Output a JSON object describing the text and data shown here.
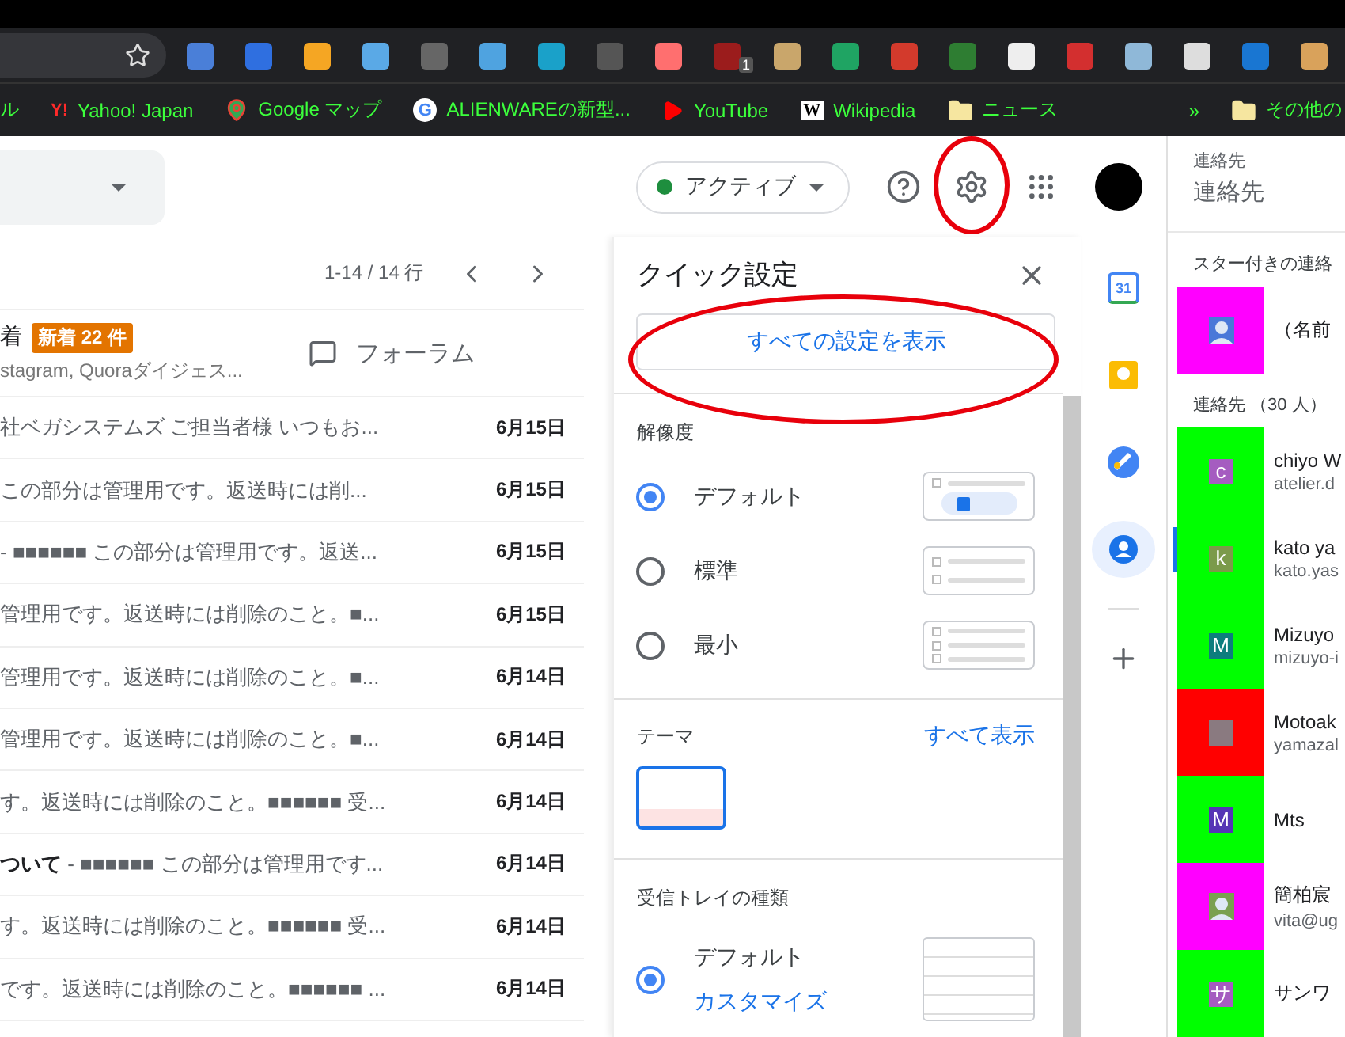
{
  "browser": {
    "extensions": [
      {
        "color": "#4a7fd8"
      },
      {
        "color": "#2f6fe0"
      },
      {
        "color": "#f5a623"
      },
      {
        "color": "#5aa9e6"
      },
      {
        "color": "#666666"
      },
      {
        "color": "#4fa3e0"
      },
      {
        "color": "#1aa1c9"
      },
      {
        "color": "#555555"
      },
      {
        "color": "#ff6f6f"
      },
      {
        "color": "#9b1c1c",
        "badge": "1"
      },
      {
        "color": "#c9a66b"
      },
      {
        "color": "#1fa463"
      },
      {
        "color": "#d33a2c"
      },
      {
        "color": "#2e7d32"
      },
      {
        "color": "#eeeeee"
      },
      {
        "color": "#d32f2f"
      },
      {
        "color": "#8fb8d8"
      },
      {
        "color": "#dddddd"
      },
      {
        "color": "#1976d2"
      },
      {
        "color": "#d9a25b"
      }
    ],
    "bookmarks": [
      {
        "kind": "plain",
        "label": "ル"
      },
      {
        "kind": "text-icon",
        "icon_text": "Y!",
        "label": "Yahoo! Japan"
      },
      {
        "kind": "pin",
        "label": "Google マップ"
      },
      {
        "kind": "text-icon-g",
        "icon_text": "G",
        "label": "ALIENWAREの新型..."
      },
      {
        "kind": "play",
        "label": "YouTube"
      },
      {
        "kind": "text-icon-w",
        "icon_text": "W",
        "label": "Wikipedia"
      },
      {
        "kind": "folder",
        "label": "ニュース"
      }
    ],
    "more": "»",
    "other_bookmarks": "その他の"
  },
  "header": {
    "status": {
      "label": "アクティブ",
      "color": "#1e8e3e"
    },
    "settings_highlighted": true
  },
  "mail": {
    "pager": "1-14 / 14 行",
    "category": {
      "title": "着",
      "badge": "新着 22 件",
      "senders": "stagram, Quoraダイジェス..."
    },
    "forum": "フォーラム",
    "rows": [
      {
        "snippet": "社ベガシステムズ ご担当者様 いつもお...",
        "date": "6月15日"
      },
      {
        "snippet": "この部分は管理用です。返送時には削...",
        "date": "6月15日"
      },
      {
        "snippet": "- ■■■■■■ この部分は管理用です。返送...",
        "date": "6月15日"
      },
      {
        "snippet": "管理用です。返送時には削除のこと。■...",
        "date": "6月15日"
      },
      {
        "snippet": "管理用です。返送時には削除のこと。■...",
        "date": "6月14日"
      },
      {
        "snippet": "管理用です。返送時には削除のこと。■...",
        "date": "6月14日"
      },
      {
        "snippet": "す。返送時には削除のこと。■■■■■■ 受...",
        "date": "6月14日"
      },
      {
        "snippet": "**ついて** - ■■■■■■ この部分は管理用です...",
        "date": "6月14日"
      },
      {
        "snippet": "す。返送時には削除のこと。■■■■■■ 受...",
        "date": "6月14日"
      },
      {
        "snippet": "です。返送時には削除のこと。■■■■■■ ...",
        "date": "6月14日"
      }
    ]
  },
  "quick_settings": {
    "title": "クイック設定",
    "all_settings": "すべての設定を表示",
    "all_settings_highlighted": true,
    "density": {
      "label": "解像度",
      "options": [
        {
          "label": "デフォルト",
          "selected": true,
          "kind": "default"
        },
        {
          "label": "標準",
          "selected": false,
          "kind": "comfortable"
        },
        {
          "label": "最小",
          "selected": false,
          "kind": "compact"
        }
      ]
    },
    "theme": {
      "label": "テーマ",
      "link": "すべて表示"
    },
    "inbox": {
      "label": "受信トレイの種類",
      "options": [
        {
          "label": "デフォルト",
          "link": "カスタマイズ",
          "selected": true
        }
      ]
    }
  },
  "side_apps": [
    {
      "kind": "calendar",
      "label": "31",
      "selected": false
    },
    {
      "kind": "keep",
      "selected": false
    },
    {
      "kind": "tasks",
      "selected": false
    },
    {
      "kind": "contacts",
      "selected": true
    }
  ],
  "contacts": {
    "overline": "連絡先",
    "title": "連絡先",
    "starred_heading": "スター付きの連絡",
    "starred": [
      {
        "name": "（名前",
        "color": "#ff00ff",
        "avatar": {
          "kind": "person",
          "color": "#4a78d8"
        }
      }
    ],
    "list_heading": "連絡先 （30 人）",
    "list": [
      {
        "name": "chiyo W",
        "email": "atelier.d",
        "color": "#00ff00",
        "avatar": {
          "kind": "letter",
          "initial": "c",
          "color": "#a55cc0"
        }
      },
      {
        "name": "kato ya",
        "email": "kato.yas",
        "color": "#00ff00",
        "avatar": {
          "kind": "letter",
          "initial": "k",
          "color": "#7b9a4a"
        }
      },
      {
        "name": "Mizuyo",
        "email": "mizuyo-i",
        "color": "#00ff00",
        "avatar": {
          "kind": "letter",
          "initial": "M",
          "color": "#0d7d7d"
        }
      },
      {
        "name": "Motoak",
        "email": "yamazal",
        "color": "#ff0000",
        "avatar": {
          "kind": "photo",
          "color": "#8a7a80"
        }
      },
      {
        "name": "Mts",
        "color": "#00ff00",
        "avatar": {
          "kind": "letter",
          "initial": "M",
          "color": "#5535b5"
        }
      },
      {
        "name": "簡柏宸",
        "email": "vita@ug",
        "color": "#ff00ff",
        "avatar": {
          "kind": "person",
          "color": "#7aa050"
        }
      },
      {
        "name": "サンワ",
        "color": "#00ff00",
        "avatar": {
          "kind": "letter",
          "initial": "サ",
          "color": "#a55cc0"
        }
      }
    ]
  }
}
